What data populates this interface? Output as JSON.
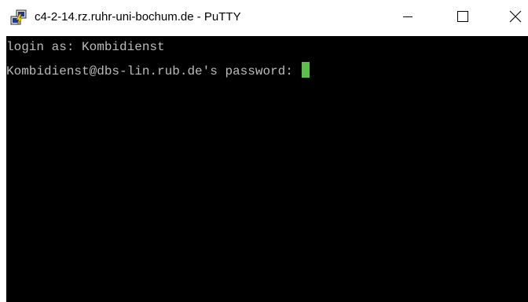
{
  "window": {
    "title": "c4-2-14.rz.ruhr-uni-bochum.de - PuTTY",
    "icon": "putty-icon",
    "controls": {
      "minimize_icon": "minimize-icon",
      "maximize_icon": "maximize-icon",
      "close_icon": "close-icon"
    }
  },
  "terminal": {
    "background": "#000000",
    "foreground": "#bbbbbb",
    "cursor_color": "#5cbf4c",
    "lines": [
      "login as: Kombidienst",
      "Kombidienst@dbs-lin.rub.de's password: "
    ]
  }
}
